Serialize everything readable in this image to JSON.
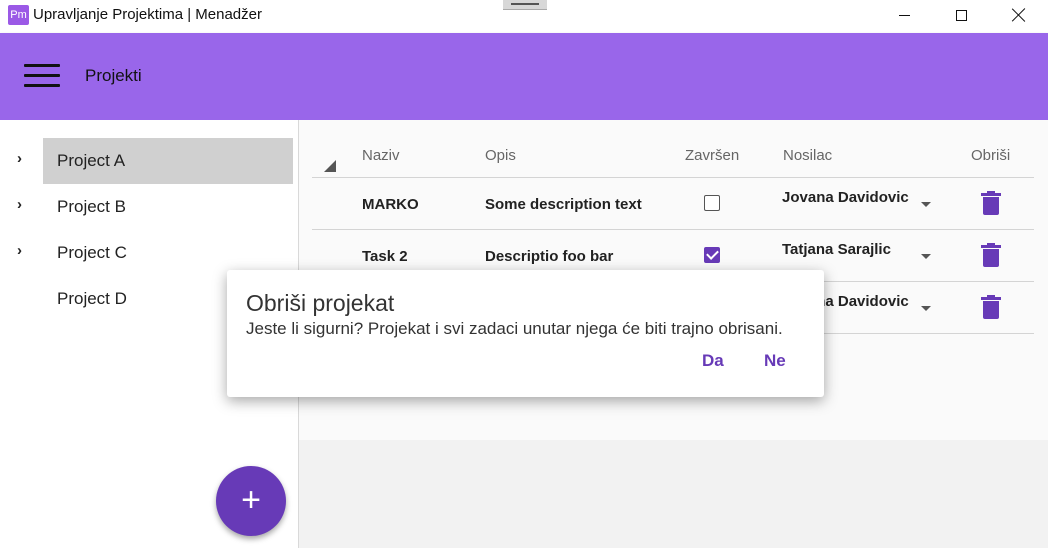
{
  "window": {
    "icon_text": "Pm",
    "title": "Upravljanje Projektima | Menadžer"
  },
  "appbar": {
    "title": "Projekti"
  },
  "sidebar": {
    "items": [
      {
        "label": "Project A",
        "expandable": true,
        "selected": true
      },
      {
        "label": "Project B",
        "expandable": true,
        "selected": false
      },
      {
        "label": "Project C",
        "expandable": true,
        "selected": false
      },
      {
        "label": "Project D",
        "expandable": false,
        "selected": false
      }
    ],
    "add_button": "+"
  },
  "table": {
    "columns": [
      "Naziv",
      "Opis",
      "Završen",
      "Nosilac",
      "Obriši"
    ],
    "rows": [
      {
        "name": "MARKO",
        "description": "Some description text",
        "done": false,
        "assignee": "Jovana Davidovic"
      },
      {
        "name": "Task 2",
        "description": "Descriptio foo bar",
        "done": true,
        "assignee": "Tatjana Sarajlic"
      },
      {
        "name": "",
        "description": "",
        "done": false,
        "assignee": "Jovana Davidovic"
      }
    ]
  },
  "dialog": {
    "title": "Obriši projekat",
    "message": "Jeste li sigurni? Projekat i svi zadaci unutar njega će biti trajno obrisani.",
    "yes": "Da",
    "no": "Ne"
  },
  "colors": {
    "appbar": "#9966ea",
    "accent": "#673ab7",
    "selected_item": "#d0d0d0"
  },
  "icons": {
    "menu": "hamburger-icon",
    "expand": "chevron-right-icon",
    "delete": "trash-icon",
    "add": "plus-icon",
    "sort": "sort-indicator-icon",
    "dropdown": "caret-down-icon"
  }
}
